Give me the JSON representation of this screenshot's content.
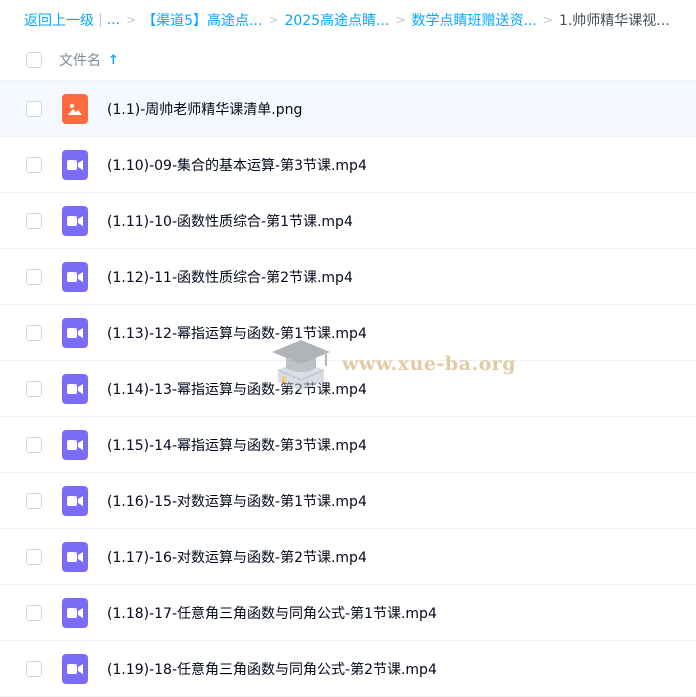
{
  "breadcrumb": {
    "back": "返回上一级",
    "ellipsis": "...",
    "crumbs": [
      "【渠道5】高途点...",
      "2025高途点睛...",
      "数学点睛班赠送资..."
    ],
    "current": "1.帅师精华课视..."
  },
  "header": {
    "column_name": "文件名",
    "sort_arrow": "↑"
  },
  "files": [
    {
      "name": "(1.1)-周帅老师精华课清单.png",
      "type": "image"
    },
    {
      "name": "(1.10)-09-集合的基本运算-第3节课.mp4",
      "type": "video"
    },
    {
      "name": "(1.11)-10-函数性质综合-第1节课.mp4",
      "type": "video"
    },
    {
      "name": "(1.12)-11-函数性质综合-第2节课.mp4",
      "type": "video"
    },
    {
      "name": "(1.13)-12-幂指运算与函数-第1节课.mp4",
      "type": "video"
    },
    {
      "name": "(1.14)-13-幂指运算与函数-第2节课.mp4",
      "type": "video"
    },
    {
      "name": "(1.15)-14-幂指运算与函数-第3节课.mp4",
      "type": "video"
    },
    {
      "name": "(1.16)-15-对数运算与函数-第1节课.mp4",
      "type": "video"
    },
    {
      "name": "(1.17)-16-对数运算与函数-第2节课.mp4",
      "type": "video"
    },
    {
      "name": "(1.18)-17-任意角三角函数与同角公式-第1节课.mp4",
      "type": "video"
    },
    {
      "name": "(1.19)-18-任意角三角函数与同角公式-第2节课.mp4",
      "type": "video"
    }
  ],
  "watermark": {
    "text": "www.xue-ba.org"
  },
  "colors": {
    "accent": "#06a7ff",
    "image_icon": "#ff6b3d",
    "video_icon": "#7b6cf6"
  }
}
